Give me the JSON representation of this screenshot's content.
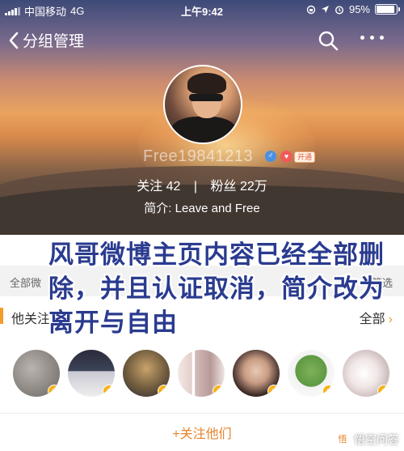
{
  "status_bar": {
    "carrier": "中国移动",
    "network": "4G",
    "time": "上午9:42",
    "battery": "95%"
  },
  "nav": {
    "back_label": "分组管理",
    "icons": [
      "chevron-left-icon",
      "search-icon",
      "more-icon"
    ]
  },
  "profile": {
    "username": "Free19841213",
    "gender_symbol": "♂",
    "badge_label": "开通",
    "following_label": "关注",
    "following_count": "42",
    "separator": "|",
    "followers_label": "粉丝",
    "followers_count": "22万",
    "bio_label": "简介:",
    "bio": "Leave and Free"
  },
  "content": {
    "tab_left": "全部微",
    "tab_right": "筛选",
    "follow_title": "他关注",
    "follow_all_label": "全部",
    "follow_button": "+关注他们",
    "verified_mark": "v"
  },
  "followed_users": [
    {
      "avatar": "grey-blurry"
    },
    {
      "avatar": "esports-player"
    },
    {
      "avatar": "game-warrior"
    },
    {
      "avatar": "split-photo"
    },
    {
      "avatar": "woman-portrait"
    },
    {
      "avatar": "pepe-frog"
    },
    {
      "avatar": "kitten"
    }
  ],
  "overlay_caption": "风哥微博主页内容已经全部删除，并且认证取消，简介改为离开与自由",
  "watermark": "悟空问答",
  "colors": {
    "accent_orange": "#e8842a",
    "caption_blue": "#2a3b8f",
    "verified_gold": "#f5b31b"
  }
}
